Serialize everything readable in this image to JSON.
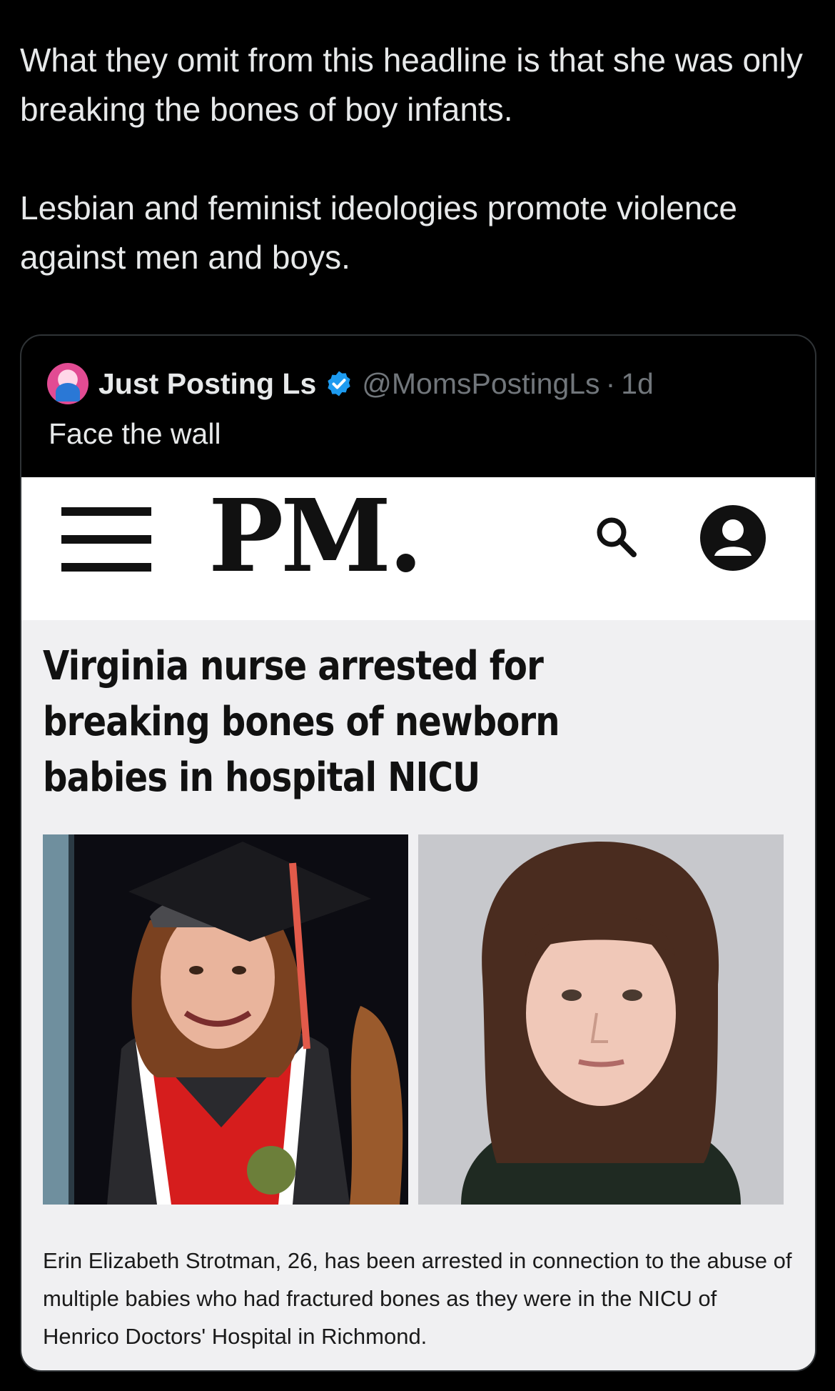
{
  "tweet": {
    "text_lines": [
      "What they omit from this headline is that she was only breaking the bones of boy infants.",
      "Lesbian and feminist ideologies promote violence against men and boys."
    ]
  },
  "quote": {
    "author_name": "Just Posting Ls",
    "author_handle": "@MomsPostingLs",
    "separator": "·",
    "time": "1d",
    "text": "Face the wall",
    "verified_color": "#1d9bf0"
  },
  "article": {
    "site_logo": "PM.",
    "headline": "Virginia nurse arrested for breaking bones of newborn babies in hospital NICU",
    "caption": "Erin Elizabeth Strotman, 26, has been arrested in connection to the abuse of multiple babies who had fractured bones as they were in the NICU of Henrico Doctors' Hospital in Richmond.",
    "icons": [
      "hamburger-icon",
      "search-icon",
      "user-icon"
    ]
  }
}
